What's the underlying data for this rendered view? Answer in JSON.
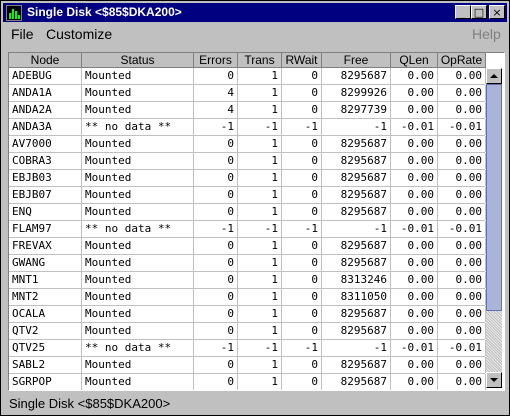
{
  "window": {
    "title": "Single Disk <$85$DKA200>"
  },
  "titlebar_buttons": {
    "minimize": "_",
    "maximize": "□",
    "close": "×"
  },
  "menu": {
    "file": "File",
    "customize": "Customize",
    "help": "Help"
  },
  "table": {
    "columns": [
      "Node",
      "Status",
      "Errors",
      "Trans",
      "RWait",
      "Free",
      "QLen",
      "OpRate"
    ],
    "rows": [
      [
        "ADEBUG",
        "Mounted",
        "0",
        "1",
        "0",
        "8295687",
        "0.00",
        "0.00"
      ],
      [
        "ANDA1A",
        "Mounted",
        "4",
        "1",
        "0",
        "8299926",
        "0.00",
        "0.00"
      ],
      [
        "ANDA2A",
        "Mounted",
        "4",
        "1",
        "0",
        "8297739",
        "0.00",
        "0.00"
      ],
      [
        "ANDA3A",
        "** no data **",
        "-1",
        "-1",
        "-1",
        "-1",
        "-0.01",
        "-0.01"
      ],
      [
        "AV7000",
        "Mounted",
        "0",
        "1",
        "0",
        "8295687",
        "0.00",
        "0.00"
      ],
      [
        "COBRA3",
        "Mounted",
        "0",
        "1",
        "0",
        "8295687",
        "0.00",
        "0.00"
      ],
      [
        "EBJB03",
        "Mounted",
        "0",
        "1",
        "0",
        "8295687",
        "0.00",
        "0.00"
      ],
      [
        "EBJB07",
        "Mounted",
        "0",
        "1",
        "0",
        "8295687",
        "0.00",
        "0.00"
      ],
      [
        "ENQ",
        "Mounted",
        "0",
        "1",
        "0",
        "8295687",
        "0.00",
        "0.00"
      ],
      [
        "FLAM97",
        "** no data **",
        "-1",
        "-1",
        "-1",
        "-1",
        "-0.01",
        "-0.01"
      ],
      [
        "FREVAX",
        "Mounted",
        "0",
        "1",
        "0",
        "8295687",
        "0.00",
        "0.00"
      ],
      [
        "GWANG",
        "Mounted",
        "0",
        "1",
        "0",
        "8295687",
        "0.00",
        "0.00"
      ],
      [
        "MNT1",
        "Mounted",
        "0",
        "1",
        "0",
        "8313246",
        "0.00",
        "0.00"
      ],
      [
        "MNT2",
        "Mounted",
        "0",
        "1",
        "0",
        "8311050",
        "0.00",
        "0.00"
      ],
      [
        "OCALA",
        "Mounted",
        "0",
        "1",
        "0",
        "8295687",
        "0.00",
        "0.00"
      ],
      [
        "QTV2",
        "Mounted",
        "0",
        "1",
        "0",
        "8295687",
        "0.00",
        "0.00"
      ],
      [
        "QTV25",
        "** no data **",
        "-1",
        "-1",
        "-1",
        "-1",
        "-0.01",
        "-0.01"
      ],
      [
        "SABL2",
        "Mounted",
        "0",
        "1",
        "0",
        "8295687",
        "0.00",
        "0.00"
      ],
      [
        "SGRPOP",
        "Mounted",
        "0",
        "1",
        "0",
        "8295687",
        "0.00",
        "0.00"
      ]
    ]
  },
  "status_bar": {
    "text": "Single Disk <$85$DKA200>"
  },
  "colors": {
    "titlebar": "#000080",
    "window": "#c0c0c0",
    "scroll_thumb": "#aab4d8"
  },
  "icons": {
    "app": "bar-chart-icon",
    "scroll_up": "arrow-up-icon",
    "scroll_down": "arrow-down-icon"
  }
}
